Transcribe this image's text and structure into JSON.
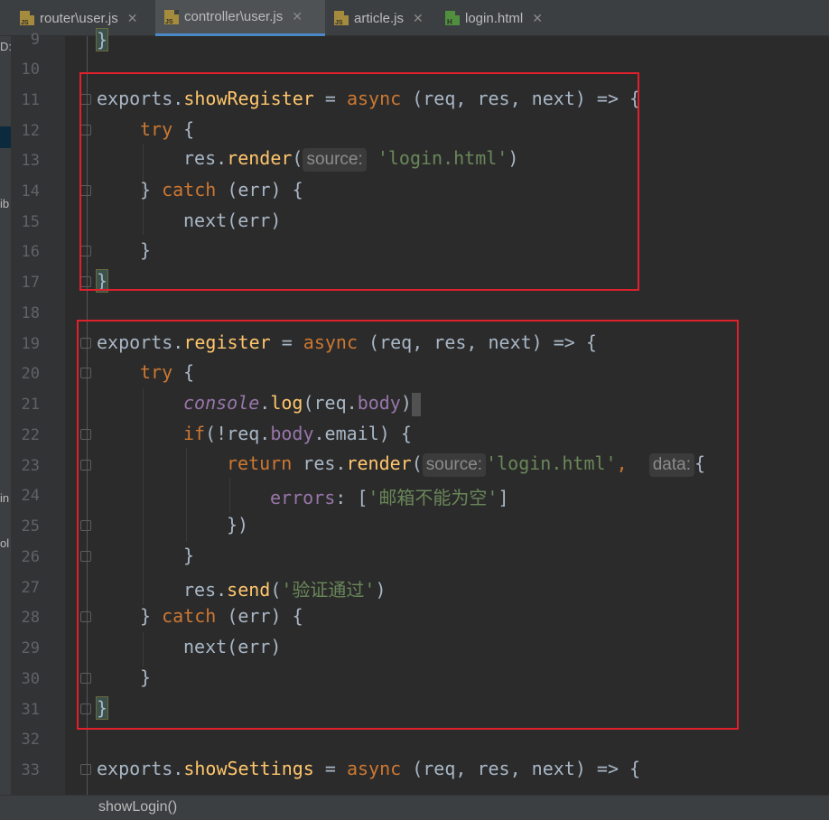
{
  "tabs": [
    {
      "label": "router\\user.js",
      "type": "js",
      "active": false
    },
    {
      "label": "controller\\user.js",
      "type": "js",
      "active": true
    },
    {
      "label": "article.js",
      "type": "js",
      "active": false
    },
    {
      "label": "login.html",
      "type": "html",
      "active": false
    }
  ],
  "left_panel": {
    "fragments": [
      "D:",
      "ib",
      "in",
      "ol"
    ]
  },
  "line_numbers": [
    "9",
    "10",
    "11",
    "12",
    "13",
    "14",
    "15",
    "16",
    "17",
    "18",
    "19",
    "20",
    "21",
    "22",
    "23",
    "24",
    "25",
    "26",
    "27",
    "28",
    "29",
    "30",
    "31",
    "32",
    "33"
  ],
  "code": {
    "l9": "}",
    "l11_a": "exports",
    "l11_b": ".",
    "l11_c": "showRegister",
    "l11_d": " = ",
    "l11_e": "async",
    "l11_f": " (req, res, next) => {",
    "try": "try",
    "catch": "catch",
    "res_render": "res.",
    "render": "render",
    "open_paren": "(",
    "hint_source": "source:",
    "hint_data": "data:",
    "str_login": "'login.html'",
    "close_paren": ")",
    "catch_tail": " (err) {",
    "next_err": "next(err)",
    "close_brace": "}",
    "open_brace": " {",
    "l19_c": "register",
    "console": "console",
    "log": "log",
    "req_body": "(req.",
    "body": "body",
    "l22_a": "if",
    "l22_b": "(!req.",
    "l22_c": ".email) {",
    "return": "return",
    "comma": ",",
    "brace": "{",
    "errors": "errors",
    "colon_bracket": ": [",
    "str_empty": "'邮箱不能为空'",
    "bracket_close": "]",
    "close_obj": "})",
    "send": "send",
    "str_pass": "'验证通过'",
    "l33_c": "showSettings"
  },
  "breadcrumb": "showLogin()",
  "colors": {
    "highlight_box": "#e0202a",
    "background": "#2b2b2b",
    "keyword": "#cc7832",
    "function": "#ffc66d",
    "string": "#6a8759"
  }
}
